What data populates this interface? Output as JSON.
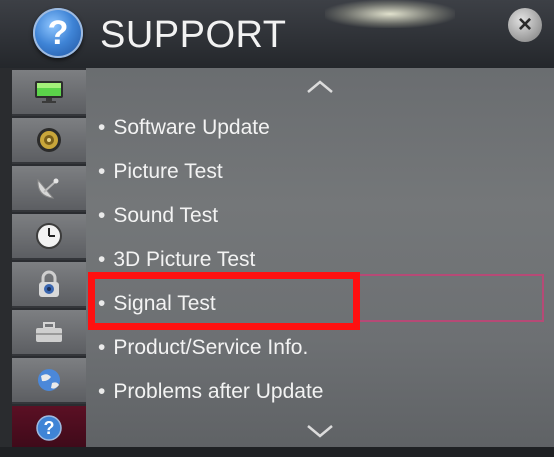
{
  "header": {
    "help_symbol": "?",
    "title": "SUPPORT",
    "close_symbol": "×"
  },
  "sidebar": {
    "items": [
      {
        "icon": "tv-picture-icon",
        "active": false
      },
      {
        "icon": "speaker-audio-icon",
        "active": false
      },
      {
        "icon": "satellite-dish-icon",
        "active": false
      },
      {
        "icon": "clock-time-icon",
        "active": false
      },
      {
        "icon": "lock-icon",
        "active": false
      },
      {
        "icon": "toolbox-option-icon",
        "active": false
      },
      {
        "icon": "globe-network-icon",
        "active": false
      },
      {
        "icon": "help-support-icon",
        "active": true,
        "symbol": "?"
      }
    ]
  },
  "menu": {
    "items": [
      {
        "label": "Software Update"
      },
      {
        "label": "Picture Test"
      },
      {
        "label": "Sound Test"
      },
      {
        "label": "3D Picture Test"
      },
      {
        "label": "Signal Test"
      },
      {
        "label": "Product/Service Info."
      },
      {
        "label": "Problems after Update"
      }
    ],
    "bullet": "•",
    "highlighted_item": "Signal Test"
  },
  "colors": {
    "highlight_box": "#ff1010",
    "focus_line": "#b64a76",
    "active_sidebar": "#4a0d1e"
  }
}
